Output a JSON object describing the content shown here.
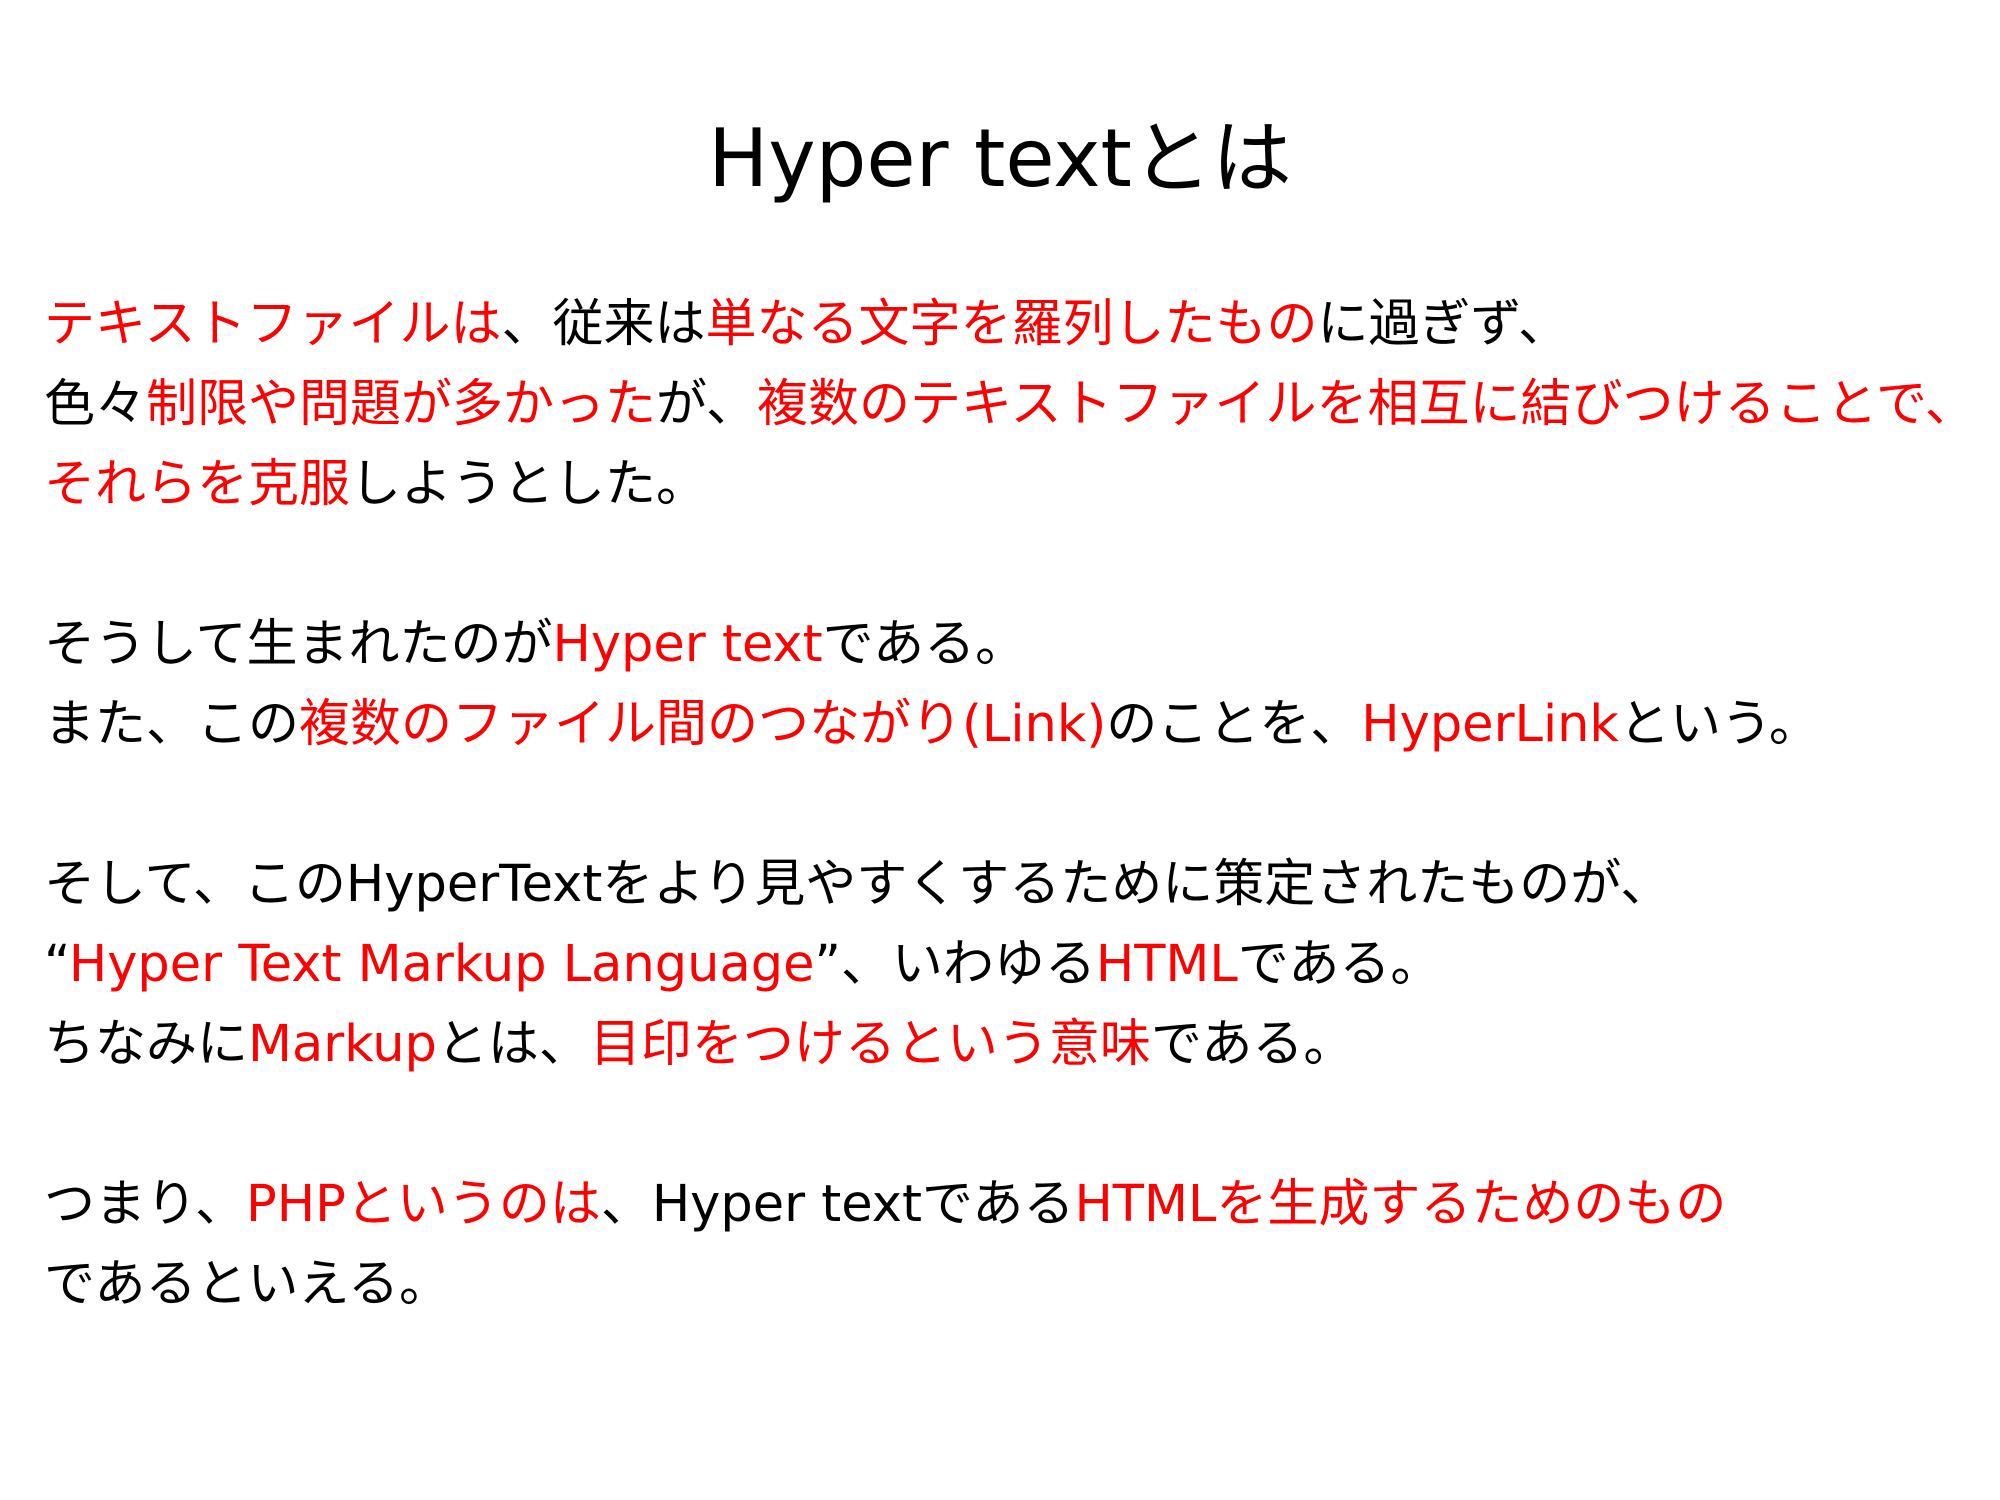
{
  "slide": {
    "title": "Hyper textとは",
    "colors": {
      "emphasis": "#ff0000",
      "normal": "#000000"
    },
    "lines": [
      {
        "segments": [
          {
            "text": "テキストファイルは",
            "emphasis": true
          },
          {
            "text": "、従来は",
            "emphasis": false
          },
          {
            "text": "単なる文字を羅列したもの",
            "emphasis": true
          },
          {
            "text": "に過ぎず、",
            "emphasis": false
          }
        ]
      },
      {
        "segments": [
          {
            "text": "色々",
            "emphasis": false
          },
          {
            "text": "制限や問題が多かった",
            "emphasis": true
          },
          {
            "text": "が、",
            "emphasis": false
          },
          {
            "text": "複数のテキストファイルを相互に結びつけることで、",
            "emphasis": true
          }
        ]
      },
      {
        "segments": [
          {
            "text": "それらを克服",
            "emphasis": true
          },
          {
            "text": "しようとした。",
            "emphasis": false
          }
        ]
      },
      {
        "segments": [
          {
            "text": "そうして生まれたのが",
            "emphasis": false
          },
          {
            "text": "Hyper text",
            "emphasis": true
          },
          {
            "text": "である。",
            "emphasis": false
          }
        ]
      },
      {
        "segments": [
          {
            "text": "また、この",
            "emphasis": false
          },
          {
            "text": "複数のファイル間のつながり(Link)",
            "emphasis": true
          },
          {
            "text": "のことを、",
            "emphasis": false
          },
          {
            "text": "HyperLink",
            "emphasis": true
          },
          {
            "text": "という。",
            "emphasis": false
          }
        ]
      },
      {
        "segments": [
          {
            "text": "そして、このHyperTextをより見やすくするために策定されたものが、",
            "emphasis": false
          }
        ]
      },
      {
        "segments": [
          {
            "text": "“",
            "emphasis": false
          },
          {
            "text": "Hyper Text Markup Language",
            "emphasis": true
          },
          {
            "text": "”、いわゆる",
            "emphasis": false
          },
          {
            "text": "HTML",
            "emphasis": true
          },
          {
            "text": "である。",
            "emphasis": false
          }
        ]
      },
      {
        "segments": [
          {
            "text": "ちなみに",
            "emphasis": false
          },
          {
            "text": "Markup",
            "emphasis": true
          },
          {
            "text": "とは、",
            "emphasis": false
          },
          {
            "text": "目印をつけるという意味",
            "emphasis": true
          },
          {
            "text": "である。",
            "emphasis": false
          }
        ]
      },
      {
        "segments": [
          {
            "text": "つまり、",
            "emphasis": false
          },
          {
            "text": "PHPというのは",
            "emphasis": true
          },
          {
            "text": "、Hyper textである",
            "emphasis": false
          },
          {
            "text": "HTMLを生成するためのもの",
            "emphasis": true
          }
        ]
      },
      {
        "segments": [
          {
            "text": "であるといえる。",
            "emphasis": false
          }
        ]
      }
    ]
  }
}
